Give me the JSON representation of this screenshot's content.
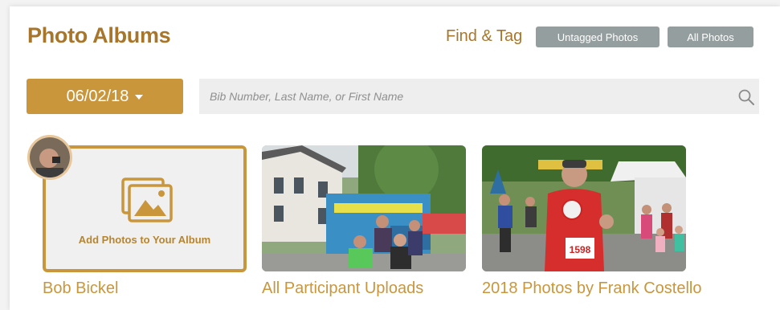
{
  "header": {
    "title": "Photo Albums",
    "find_tag_label": "Find & Tag",
    "untagged_button": "Untagged Photos",
    "all_button": "All Photos"
  },
  "filters": {
    "date_value": "06/02/18",
    "search_placeholder": "Bib Number, Last Name, or First Name"
  },
  "albums": [
    {
      "caption": "Bob Bickel",
      "add_label": "Add Photos to Your Album",
      "icon": "image-gallery-icon",
      "avatar": "avatar"
    },
    {
      "caption": "All Participant Uploads"
    },
    {
      "caption": "2018 Photos by Frank Costello",
      "bib_number": "1598"
    }
  ],
  "colors": {
    "accent": "#c9963c",
    "title": "#a8762a",
    "gray_button": "#949e9e",
    "search_bg": "#eeeeee"
  }
}
